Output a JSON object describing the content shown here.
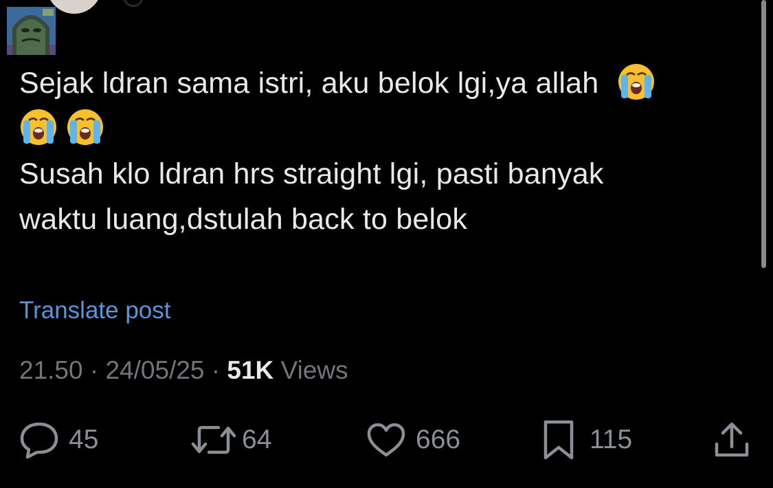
{
  "tweet": {
    "line1": "Sejak ldran sama istri, aku belok lgi,ya allah",
    "line3": "Susah klo ldran hrs straight lgi, pasti banyak",
    "line4": "waktu luang,dstulah back to belok",
    "emoji_name": "loudly-crying-face-emoji"
  },
  "translate_label": "Translate post",
  "meta": {
    "time": "21.50",
    "separator": "·",
    "date": "24/05/25",
    "views_count": "51K",
    "views_label": "Views"
  },
  "actions": {
    "reply_count": "45",
    "repost_count": "64",
    "like_count": "666",
    "bookmark_count": "115"
  },
  "colors": {
    "background": "#000000",
    "text": "#e7e9ea",
    "muted": "#71767b",
    "link": "#5b95d9"
  },
  "icons": [
    "reply-icon",
    "repost-icon",
    "like-icon",
    "bookmark-icon",
    "share-icon"
  ]
}
